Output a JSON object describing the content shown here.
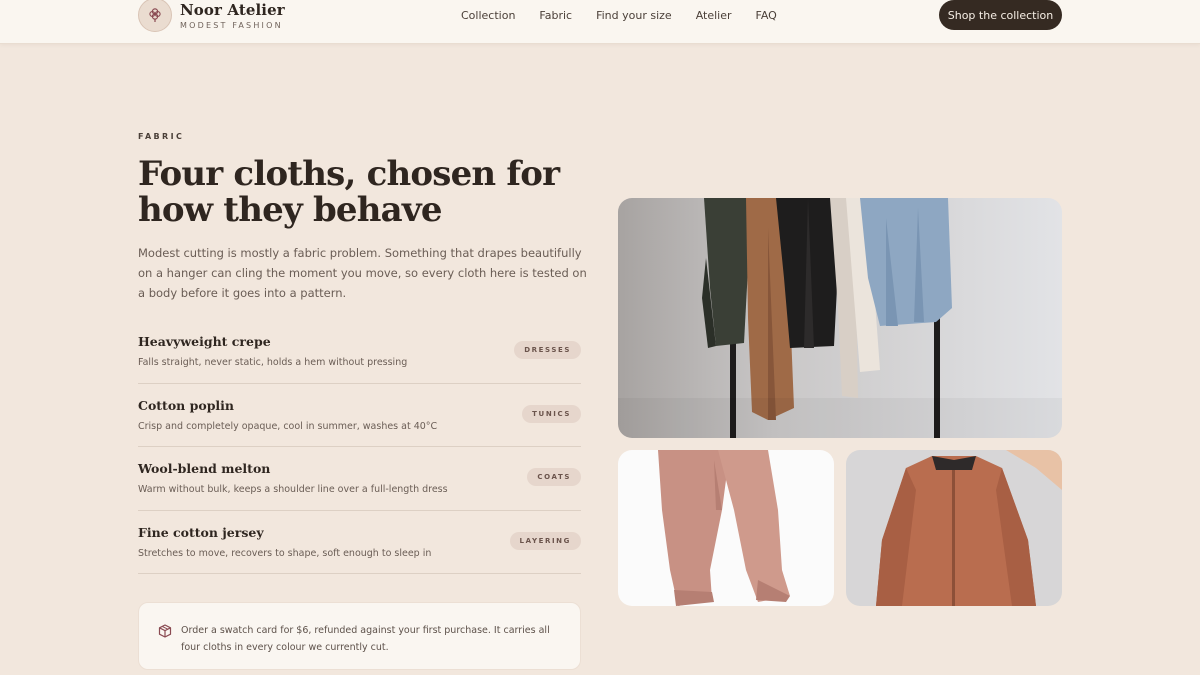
{
  "brand": {
    "name": "Noor Atelier",
    "tagline": "MODEST FASHION",
    "logo_icon": "flower-icon"
  },
  "nav": {
    "items": [
      "Collection",
      "Fabric",
      "Find your size",
      "Atelier",
      "FAQ"
    ],
    "cta_label": "Shop the collection"
  },
  "section": {
    "eyebrow": "FABRIC",
    "title": "Four cloths, chosen for how they behave",
    "intro": "Modest cutting is mostly a fabric problem. Something that drapes beautifully on a hanger can cling the moment you move, so every cloth here is tested on a body before it goes into a pattern."
  },
  "fabrics": [
    {
      "name": "Heavyweight crepe",
      "description": "Falls straight, never static, holds a hem without pressing",
      "tag": "DRESSES"
    },
    {
      "name": "Cotton poplin",
      "description": "Crisp and completely opaque, cool in summer, washes at 40°C",
      "tag": "TUNICS"
    },
    {
      "name": "Wool-blend melton",
      "description": "Warm without bulk, keeps a shoulder line over a full-length dress",
      "tag": "COATS"
    },
    {
      "name": "Fine cotton jersey",
      "description": "Stretches to move, recovers to shape, soft enough to sleep in",
      "tag": "LAYERING"
    }
  ],
  "swatch_note": {
    "icon": "box-icon",
    "text": "Order a swatch card for $6, refunded against your first purchase. It carries all four cloths in every colour we currently cut."
  },
  "colors": {
    "page_bg": "#f2e7dd",
    "header_bg": "#faf6f0",
    "cta_bg": "#352a22",
    "tag_bg": "#e6d6cc",
    "accent": "#8a4a52"
  }
}
